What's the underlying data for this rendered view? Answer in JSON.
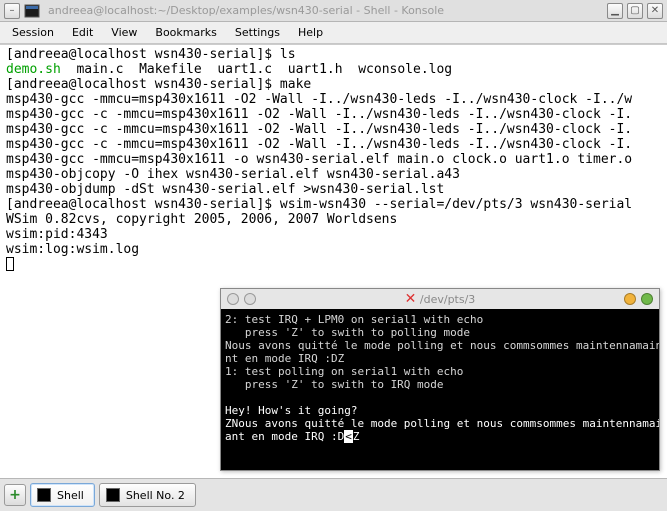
{
  "window": {
    "title": "andreea@localhost:~/Desktop/examples/wsn430-serial - Shell - Konsole"
  },
  "menu": {
    "session": "Session",
    "edit": "Edit",
    "view": "View",
    "bookmarks": "Bookmarks",
    "settings": "Settings",
    "help": "Help"
  },
  "term": {
    "l01": "[andreea@localhost wsn430-serial]$ ls",
    "l02_a": "demo.sh",
    "l02_b": "  main.c  Makefile  uart1.c  uart1.h  wconsole.log",
    "l03": "[andreea@localhost wsn430-serial]$ make",
    "l04": "msp430-gcc -mmcu=msp430x1611 -O2 -Wall -I../wsn430-leds -I../wsn430-clock -I../w",
    "l05": "msp430-gcc -c -mmcu=msp430x1611 -O2 -Wall -I../wsn430-leds -I../wsn430-clock -I.",
    "l06": "msp430-gcc -c -mmcu=msp430x1611 -O2 -Wall -I../wsn430-leds -I../wsn430-clock -I.",
    "l07": "msp430-gcc -c -mmcu=msp430x1611 -O2 -Wall -I../wsn430-leds -I../wsn430-clock -I.",
    "l08": "msp430-gcc -mmcu=msp430x1611 -o wsn430-serial.elf main.o clock.o uart1.o timer.o",
    "l09": "msp430-objcopy -O ihex wsn430-serial.elf wsn430-serial.a43",
    "l10": "msp430-objdump -dSt wsn430-serial.elf >wsn430-serial.lst",
    "l11": "[andreea@localhost wsn430-serial]$ wsim-wsn430 --serial=/dev/pts/3 wsn430-serial",
    "l12": "WSim 0.82cvs, copyright 2005, 2006, 2007 Worldsens",
    "l13": "wsim:pid:4343",
    "l14": "wsim:log:wsim.log"
  },
  "pts": {
    "title": "/dev/pts/3",
    "l01": "2: test IRQ + LPM0 on serial1 with echo",
    "l02": "   press 'Z' to swith to polling mode",
    "l03": "Nous avons quitté le mode polling et nous commsommes maintennamaintena",
    "l04": "nt en mode IRQ :DZ",
    "l05": "1: test polling on serial1 with echo",
    "l06": "   press 'Z' to swith to IRQ mode",
    "blank": " ",
    "l07": "Hey! How's it going?",
    "l08": "ZNous avons quitté le mode polling et nous commsommes maintennamainten",
    "l09a": "ant en mode IRQ :D",
    "l09b": "<",
    "l09c": "Z"
  },
  "tabs": {
    "t1": "Shell",
    "t2": "Shell No. 2"
  }
}
